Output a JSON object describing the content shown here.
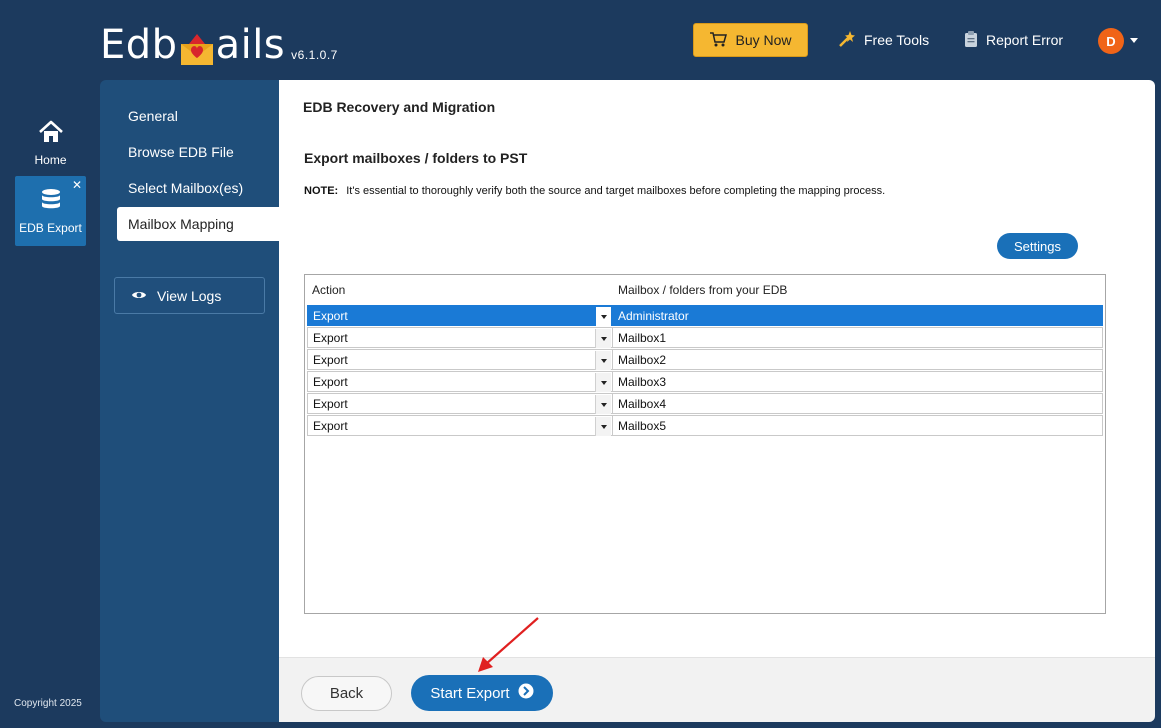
{
  "header": {
    "logo_left": "Edb",
    "logo_right": "ails",
    "version": "v6.1.0.7",
    "buy_now": "Buy Now",
    "free_tools": "Free Tools",
    "report_error": "Report Error",
    "avatar_initial": "D"
  },
  "rail": {
    "home": "Home",
    "edb_export": "EDB Export",
    "close": "✕",
    "copyright": "Copyright 2025"
  },
  "steps": {
    "general": "General",
    "browse": "Browse EDB  File",
    "select": "Select Mailbox(es)",
    "mapping": "Mailbox Mapping",
    "view_logs": "View Logs"
  },
  "main": {
    "page_title": "EDB Recovery and Migration",
    "section_title": "Export mailboxes / folders to PST",
    "note_label": "NOTE:",
    "note_text": "It's essential to thoroughly verify both the source and target mailboxes before completing the mapping process.",
    "settings": "Settings"
  },
  "grid": {
    "col_action": "Action",
    "col_mailbox": "Mailbox / folders from your EDB",
    "rows": [
      {
        "action": "Export",
        "mailbox": "Administrator"
      },
      {
        "action": "Export",
        "mailbox": "Mailbox1"
      },
      {
        "action": "Export",
        "mailbox": "Mailbox2"
      },
      {
        "action": "Export",
        "mailbox": "Mailbox3"
      },
      {
        "action": "Export",
        "mailbox": "Mailbox4"
      },
      {
        "action": "Export",
        "mailbox": "Mailbox5"
      }
    ]
  },
  "footer": {
    "back": "Back",
    "start_export": "Start Export"
  },
  "colors": {
    "accent": "#1a70b8",
    "buy": "#f5b731",
    "background": "#1c3a5e",
    "selection": "#1a7ad6",
    "annotation_arrow": "#e02020"
  }
}
